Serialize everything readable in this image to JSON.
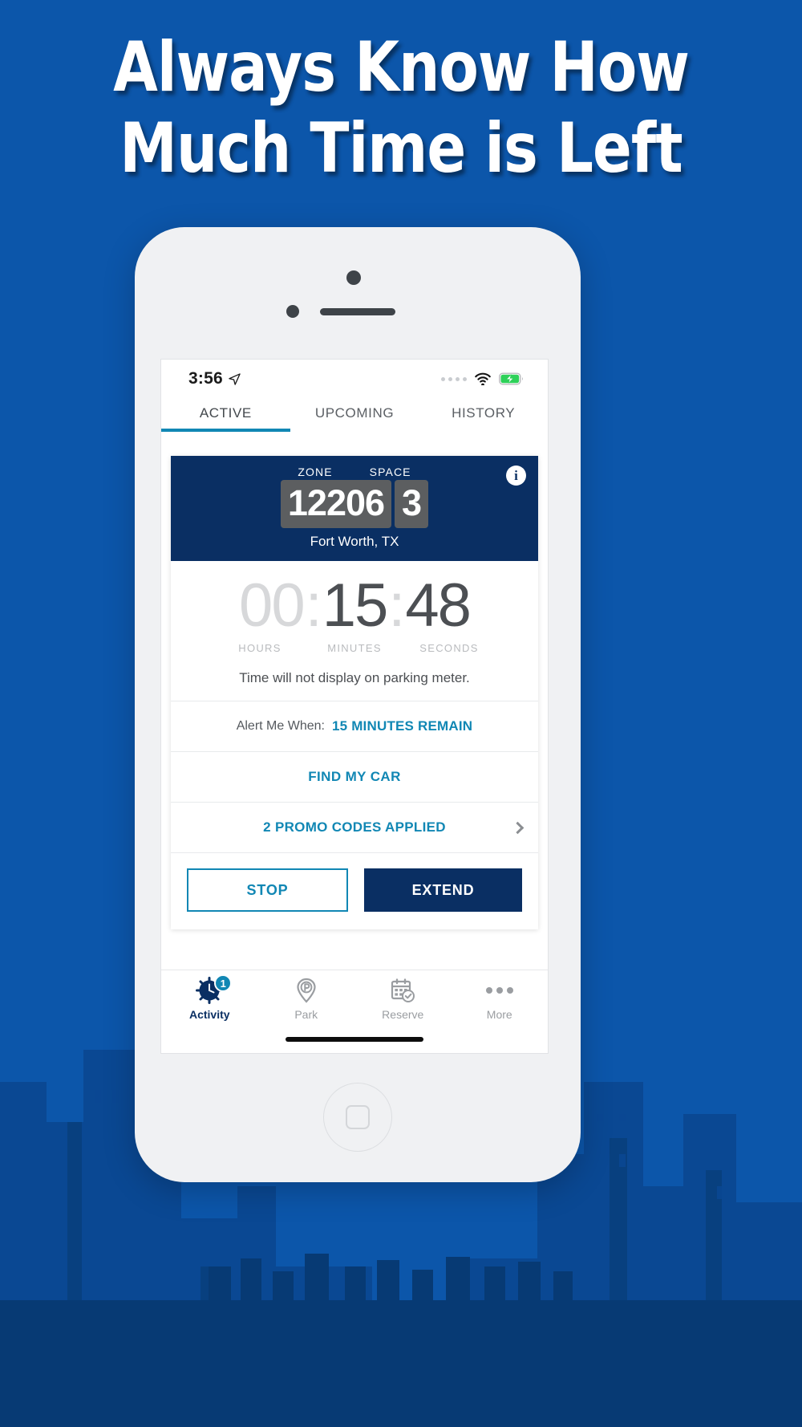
{
  "promo": {
    "headline_line1": "Always Know How",
    "headline_line2": "Much Time is Left",
    "background_color": "#0c56aa"
  },
  "phone": {
    "status_bar": {
      "time": "3:56",
      "location_icon": "location-arrow-icon",
      "signal_icon": "signal-dots-icon",
      "wifi_icon": "wifi-icon",
      "battery_icon": "battery-charging-icon",
      "battery_color": "#2ed159"
    },
    "tabs": [
      {
        "label": "ACTIVE",
        "active": true
      },
      {
        "label": "UPCOMING",
        "active": false
      },
      {
        "label": "HISTORY",
        "active": false
      }
    ],
    "tab_accent_color": "#1187b4",
    "session_card": {
      "zone_label": "ZONE",
      "space_label": "SPACE",
      "zone_value": "12206",
      "space_value": "3",
      "city": "Fort Worth, TX",
      "info_icon": "info-icon",
      "header_color": "#0a2f63",
      "timer": {
        "hours": "00",
        "minutes": "15",
        "seconds": "48",
        "separator": ":",
        "hours_label": "HOURS",
        "minutes_label": "MINUTES",
        "seconds_label": "SECONDS"
      },
      "meter_note": "Time will not display on parking meter.",
      "alert_label": "Alert Me When:",
      "alert_value": "15 MINUTES REMAIN",
      "find_my_car": "FIND MY CAR",
      "promo_codes": "2 PROMO CODES APPLIED",
      "promo_chevron_icon": "chevron-right-icon",
      "stop_button": "STOP",
      "extend_button": "EXTEND",
      "link_color": "#1187b4"
    },
    "bottom_nav": [
      {
        "label": "Activity",
        "icon": "clock-icon",
        "badge": "1",
        "active": true
      },
      {
        "label": "Park",
        "icon": "parking-pin-icon",
        "badge": "",
        "active": false
      },
      {
        "label": "Reserve",
        "icon": "calendar-check-icon",
        "badge": "",
        "active": false
      },
      {
        "label": "More",
        "icon": "ellipsis-icon",
        "badge": "",
        "active": false
      }
    ]
  }
}
